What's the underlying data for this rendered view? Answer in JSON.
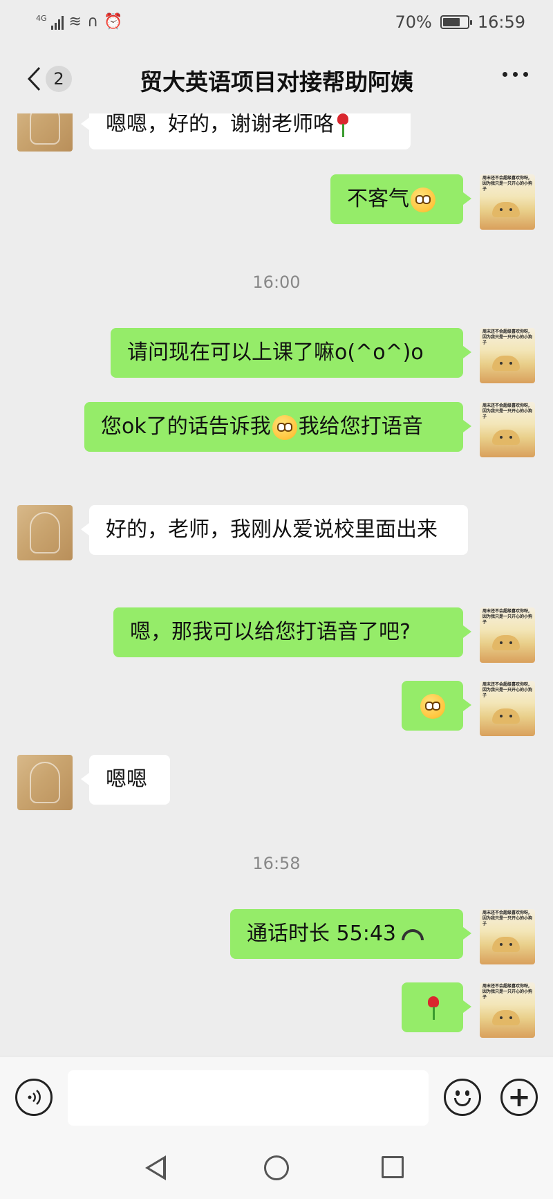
{
  "status_bar": {
    "network": "4G",
    "battery_percent_text": "70%",
    "battery_level": 0.7,
    "time": "16:59"
  },
  "header": {
    "unread_count": "2",
    "title": "贸大英语项目对接帮助阿姨"
  },
  "avatar_caption": "周末还不会超级喜欢你呀, 因为我只是一只开心的小狗子",
  "messages": [
    {
      "sender": "other",
      "text": "嗯嗯，好的，谢谢老师咯",
      "emoji": "rose-icon"
    },
    {
      "sender": "self",
      "text": "不客气",
      "emoji": "peek-face-icon"
    },
    {
      "type": "time",
      "text": "16:00"
    },
    {
      "sender": "self",
      "text": "请问现在可以上课了嘛o(^o^)o"
    },
    {
      "sender": "self",
      "text_before": "您ok了的话告诉我",
      "emoji": "peek-face-icon",
      "text_after": "我给您打语音"
    },
    {
      "sender": "other",
      "text": "好的，老师，我刚从爱说校里面出来"
    },
    {
      "sender": "self",
      "text": "嗯，那我可以给您打语音了吧?"
    },
    {
      "sender": "self",
      "emoji": "peek-face-icon"
    },
    {
      "sender": "other",
      "text": "嗯嗯"
    },
    {
      "type": "time",
      "text": "16:58"
    },
    {
      "sender": "self",
      "text": "通话时长 55:43",
      "emoji": "call-icon"
    },
    {
      "sender": "self",
      "emoji": "rose-icon"
    }
  ],
  "input": {
    "value": "",
    "placeholder": ""
  }
}
